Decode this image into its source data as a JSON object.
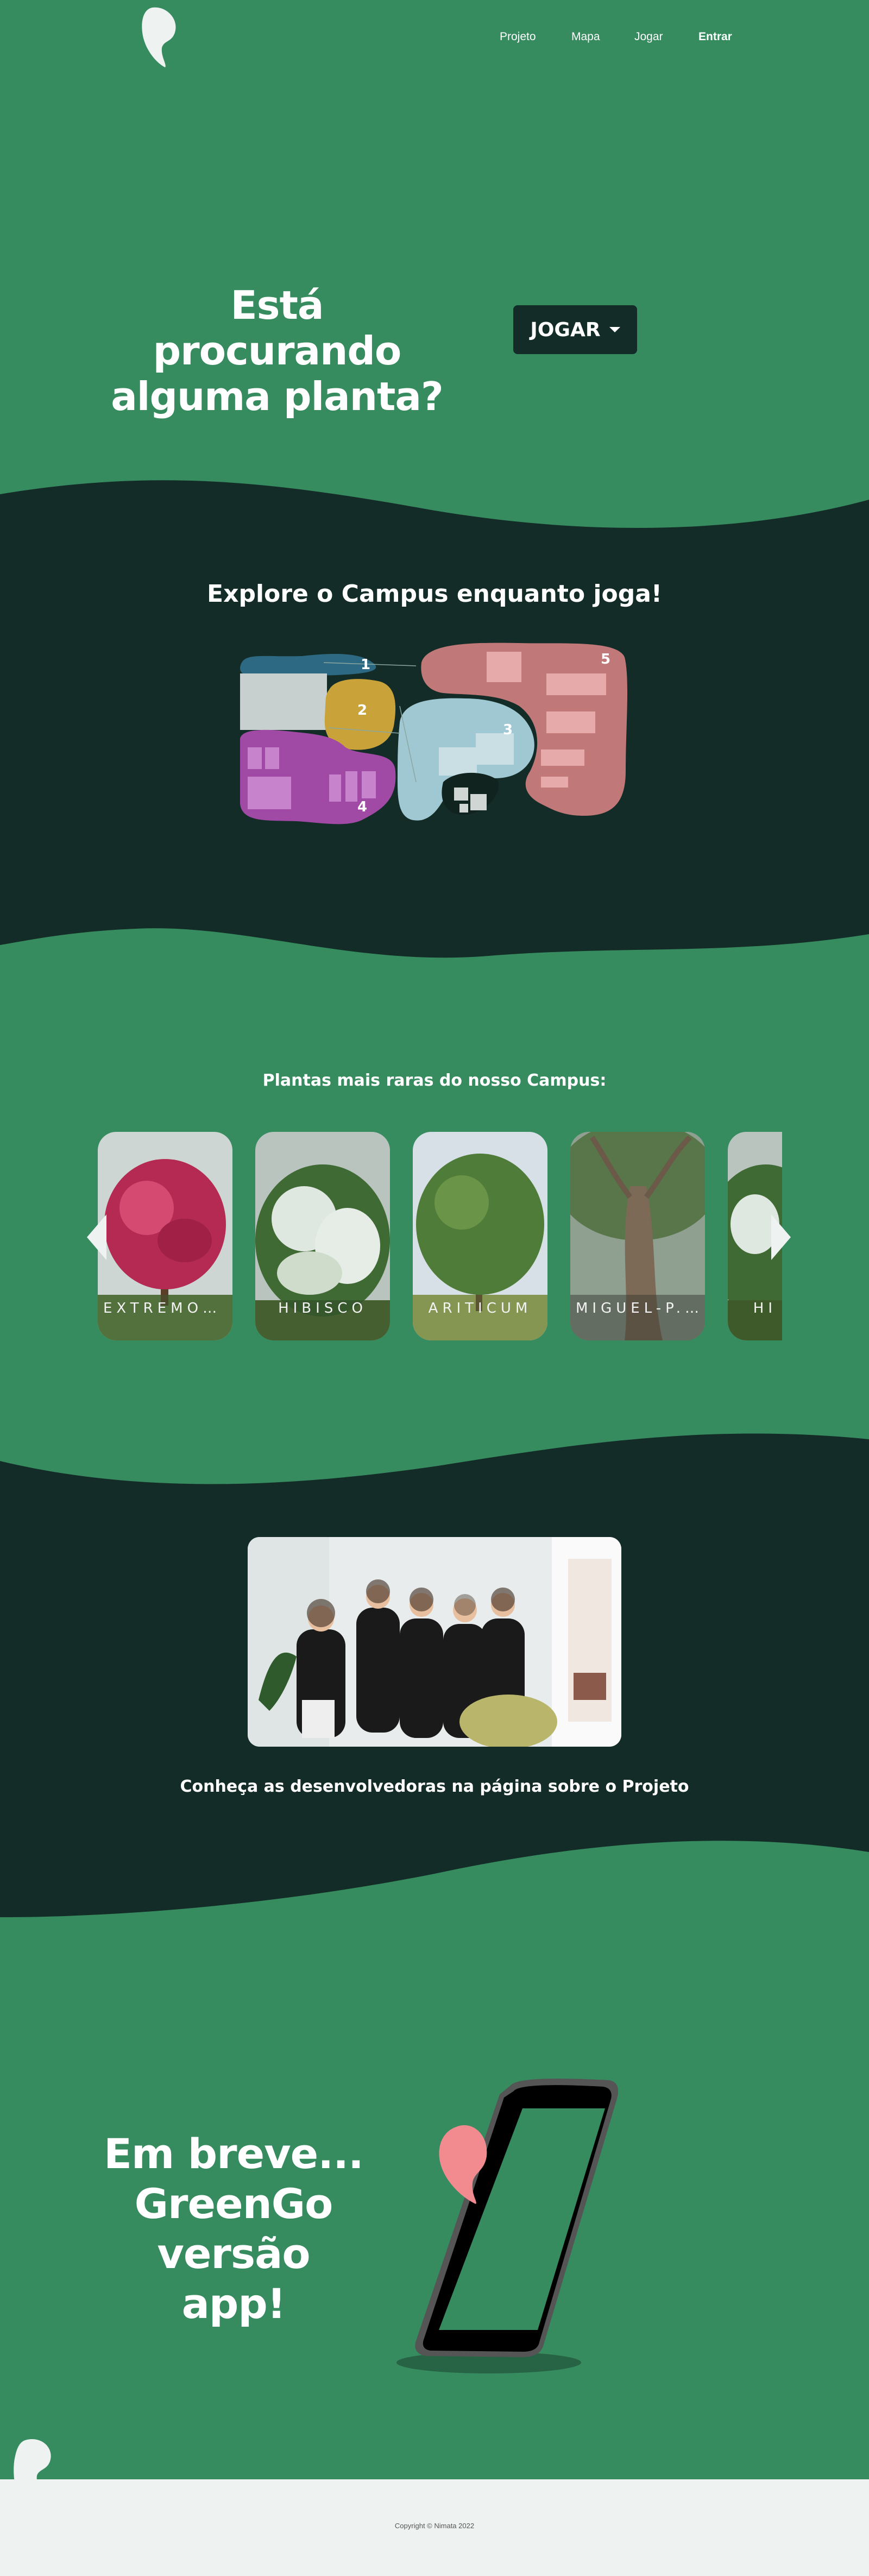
{
  "nav": {
    "links": [
      {
        "label": "Projeto"
      },
      {
        "label": "Mapa"
      },
      {
        "label": "Jogar"
      },
      {
        "label": "Entrar"
      }
    ]
  },
  "hero": {
    "title_line1": "Está procurando",
    "title_line2": "alguma planta?",
    "button_label": "JOGAR"
  },
  "map_section": {
    "title": "Explore o Campus enquanto joga!",
    "zones": [
      "1",
      "2",
      "3",
      "4",
      "5"
    ]
  },
  "plants": {
    "title": "Plantas mais raras do nosso Campus:",
    "cards": [
      {
        "label": "EXTREMOSA"
      },
      {
        "label": "HIBISCO"
      },
      {
        "label": "ARITICUM"
      },
      {
        "label": "MIGUEL-P..."
      },
      {
        "label": "HI"
      }
    ]
  },
  "team": {
    "caption": "Conheça as desenvolvedoras na página sobre o Projeto"
  },
  "app": {
    "line1": "Em breve...",
    "line2": "GreenGo",
    "line3": "versão app!"
  },
  "footer": {
    "copyright": "Copyright © Nimata 2022"
  },
  "colors": {
    "green": "#368b5f",
    "dark": "#142c28",
    "footer_bg": "#eef3f2",
    "logo_white": "#eef3f2",
    "logo_pink": "#f28b8f"
  },
  "icons": [
    "leaf-logo-icon",
    "caret-down-icon",
    "chevron-left-icon",
    "chevron-right-icon"
  ]
}
